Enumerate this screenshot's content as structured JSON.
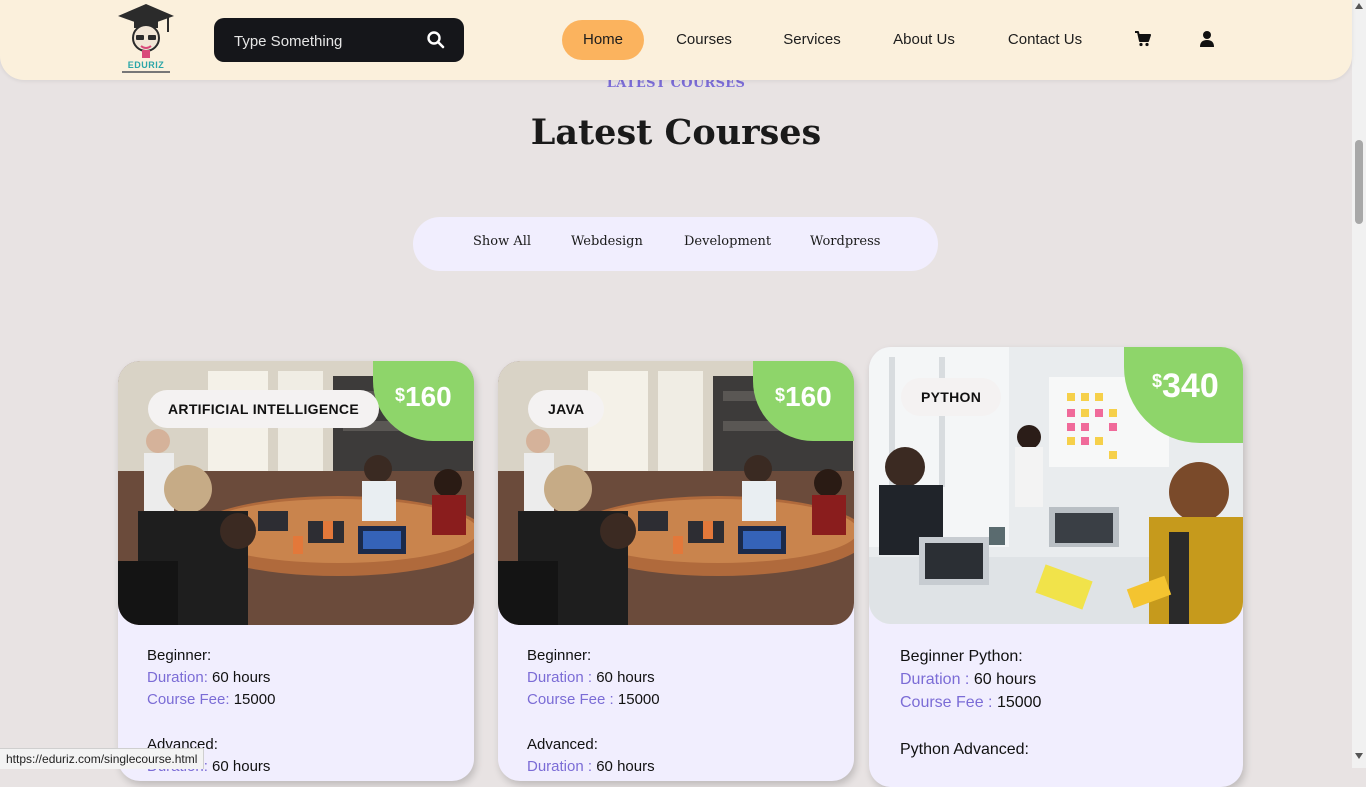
{
  "header": {
    "logo_text": "EDURIZ",
    "search_placeholder": "Type Something",
    "nav": [
      "Home",
      "Courses",
      "Services",
      "About Us",
      "Contact Us"
    ],
    "active_nav": "Home",
    "icons": [
      "cart-icon",
      "user-icon"
    ]
  },
  "section": {
    "eyebrow": "LATEST COURSES",
    "title": "Latest Courses"
  },
  "filters": [
    "Show All",
    "Webdesign",
    "Development",
    "Wordpress"
  ],
  "cards": [
    {
      "tag": "ARTIFICIAL INTELLIGENCE",
      "currency": "$",
      "price": "160",
      "level1": "Beginner:",
      "duration_label": "Duration:",
      "duration_value": "60 hours",
      "fee_label": "Course Fee:",
      "fee_value": "15000",
      "level2": "Advanced:",
      "duration2_label": "Duration:",
      "duration2_value": "60 hours"
    },
    {
      "tag": "JAVA",
      "currency": "$",
      "price": "160",
      "level1": "Beginner:",
      "duration_label": "Duration :",
      "duration_value": "60 hours",
      "fee_label": "Course Fee :",
      "fee_value": "15000",
      "level2": "Advanced:",
      "duration2_label": "Duration :",
      "duration2_value": "60 hours"
    },
    {
      "tag": "PYTHON",
      "currency": "$",
      "price": "340",
      "level1": "Beginner Python:",
      "duration_label": "Duration :",
      "duration_value": "60 hours",
      "fee_label": "Course Fee :",
      "fee_value": "15000",
      "level2": "Python Advanced:"
    }
  ],
  "status_url": "https://eduriz.com/singlecourse.html",
  "colors": {
    "header_bg": "#fbf0dc",
    "active_nav": "#fbb35e",
    "accent": "#7b6cd6",
    "price_badge": "#8ed56a",
    "card_bg": "#f1eefe",
    "page_bg": "#e8e3e3"
  }
}
